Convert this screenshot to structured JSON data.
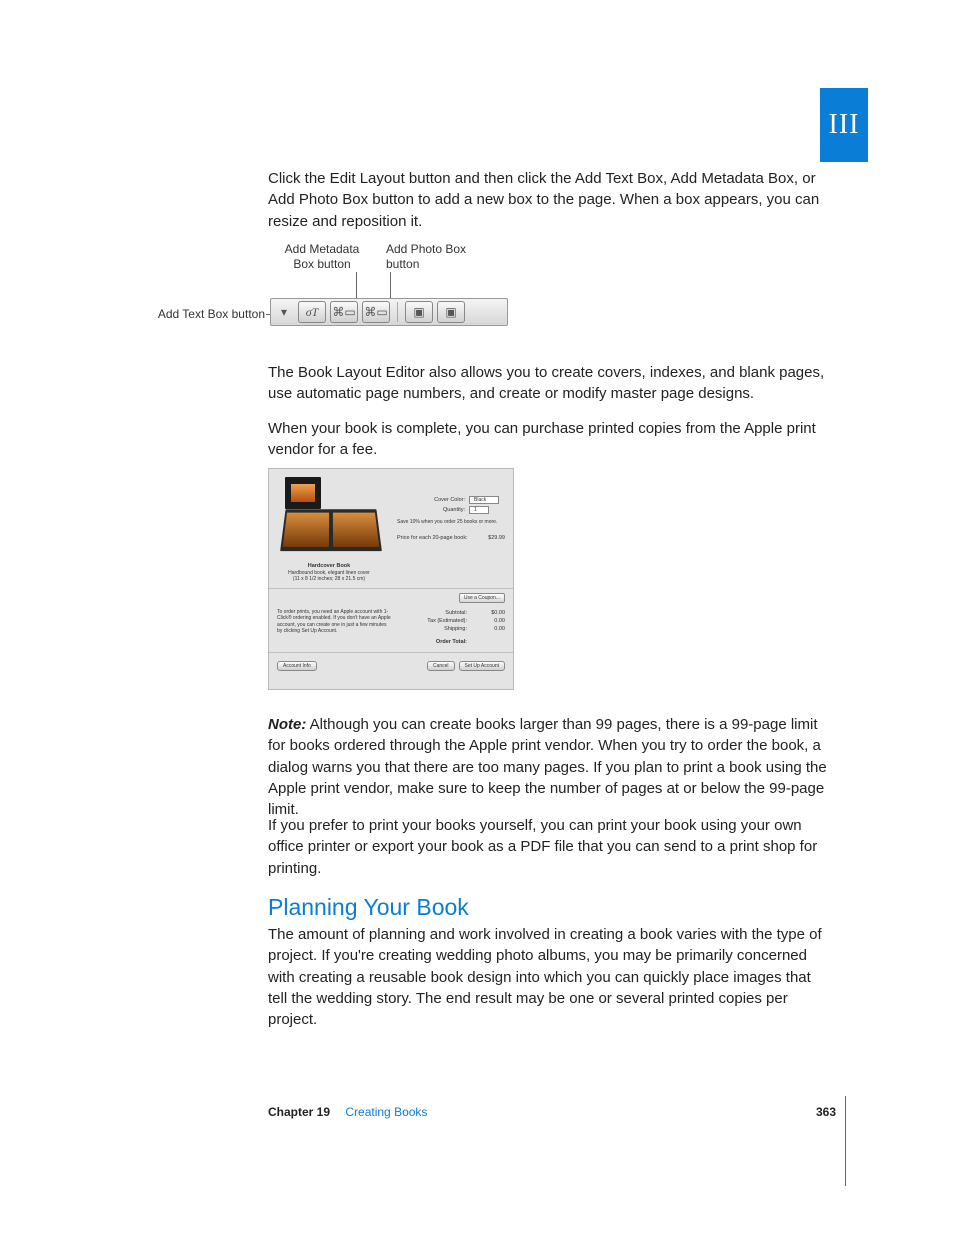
{
  "part_label": "III",
  "paragraphs": {
    "intro": "Click the Edit Layout button and then click the Add Text Box, Add Metadata Box, or Add Photo Box button to add a new box to the page. When a box appears, you can resize and reposition it.",
    "allows": "The Book Layout Editor also allows you to create covers, indexes, and blank pages, use automatic page numbers, and create or modify master page designs.",
    "purchase": "When your book is complete, you can purchase printed copies from the Apple print vendor for a fee.",
    "note_label": "Note:",
    "note_body": "  Although you can create books larger than 99 pages, there is a 99-page limit for books ordered through the Apple print vendor. When you try to order the book, a dialog warns you that there are too many pages. If you plan to print a book using the Apple print vendor, make sure to keep the number of pages at or below the 99-page limit.",
    "self_print": "If you prefer to print your books yourself, you can print your book using your own office printer or export your book as a PDF file that you can send to a print shop for printing.",
    "planning": "The amount of planning and work involved in creating a book varies with the type of project. If you're creating wedding photo albums, you may be primarily concerned with creating a reusable book design into which you can quickly place images that tell the wedding story. The end result may be one or several printed copies per project."
  },
  "heading": "Planning Your Book",
  "toolbar": {
    "callouts": {
      "text_box": "Add Text Box button",
      "metadata": "Add Metadata\nBox button",
      "photo": "Add Photo Box\nbutton"
    }
  },
  "order_dialog": {
    "product_title": "Hardcover Book",
    "product_sub1": "Hardbound book, elegant linen cover",
    "product_sub2": "(11 x 8 1/2 inches; 28 x 21.5 cm)",
    "cover_color_label": "Cover Color:",
    "cover_color_value": "Black",
    "quantity_label": "Quantity:",
    "quantity_value": "1",
    "save_note": "Save 10% when you order 25 books or more.",
    "unit_price_label": "Price for each 20-page book:",
    "unit_price": "$29.99",
    "coupon_btn": "Use a Coupon...",
    "account_note": "To order prints, you need an Apple account with 1-Click® ordering enabled. If you don't have an Apple account, you can create one in just a few minutes by clicking Set Up Account.",
    "subtotal_label": "Subtotal:",
    "subtotal": "$0.00",
    "tax_label": "Tax (Estimated):",
    "tax": "0.00",
    "shipping_label": "Shipping:",
    "shipping": "0.00",
    "order_total_label": "Order Total:",
    "order_total": "",
    "account_info_btn": "Account Info",
    "cancel_btn": "Cancel",
    "setup_btn": "Set Up Account"
  },
  "footer": {
    "chapter": "Chapter 19",
    "title": "Creating Books",
    "page": "363"
  }
}
